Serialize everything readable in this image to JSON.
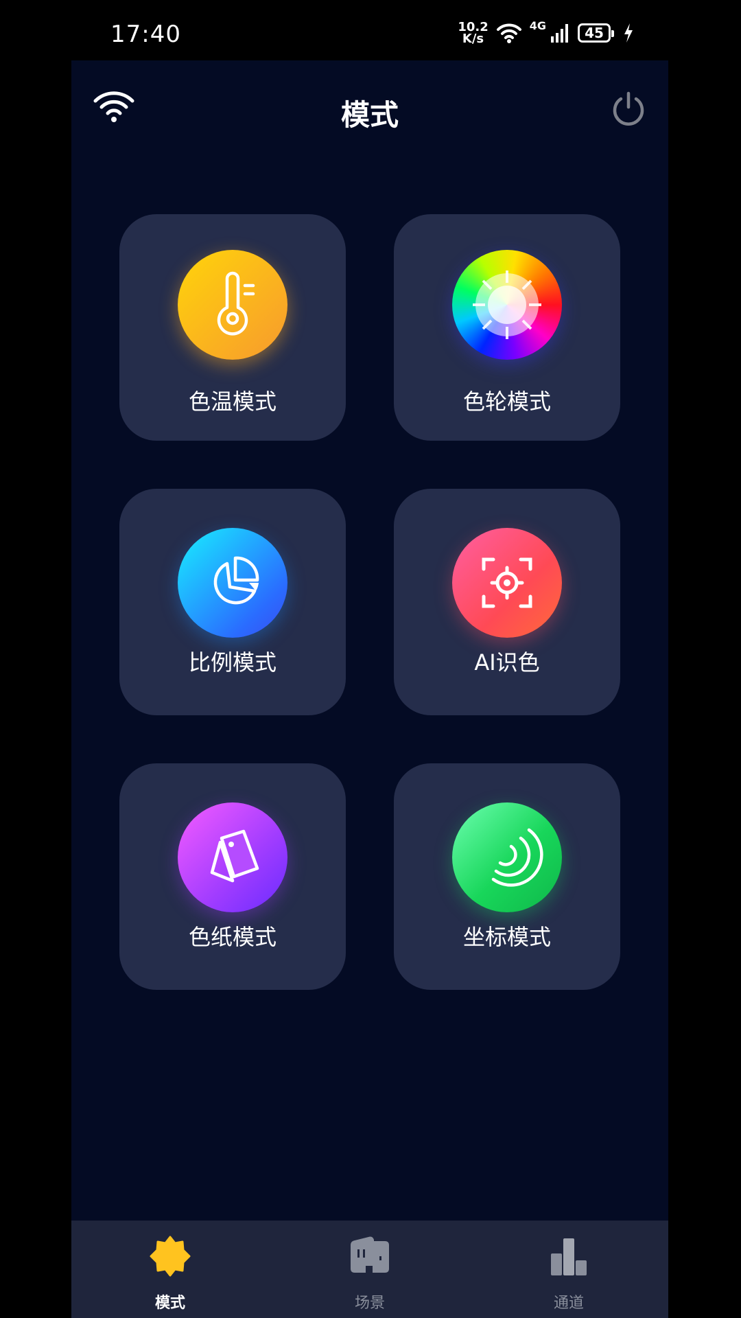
{
  "status_bar": {
    "time": "17:40",
    "net_speed_value": "10.2",
    "net_speed_unit": "K/s",
    "network_type": "4G",
    "battery": "45",
    "charging": true
  },
  "header": {
    "title": "模式"
  },
  "modes": [
    {
      "label": "色温模式",
      "icon": "thermometer-icon",
      "color": "#FFC107"
    },
    {
      "label": "色轮模式",
      "icon": "color-wheel-icon",
      "color": "rainbow"
    },
    {
      "label": "比例模式",
      "icon": "pie-chart-icon",
      "color": "#2A7BFF"
    },
    {
      "label": "AI识色",
      "icon": "scan-target-icon",
      "color": "#FF4F6A"
    },
    {
      "label": "色纸模式",
      "icon": "color-paper-icon",
      "color": "#B03CFF"
    },
    {
      "label": "坐标模式",
      "icon": "arc-icon",
      "color": "#1ED760"
    }
  ],
  "bottom_nav": {
    "items": [
      {
        "label": "模式",
        "icon": "mode-star-icon",
        "active": true
      },
      {
        "label": "场景",
        "icon": "scene-icon",
        "active": false
      },
      {
        "label": "通道",
        "icon": "channel-bars-icon",
        "active": false
      }
    ]
  },
  "colors": {
    "background": "#040B24",
    "card": "#252D4B",
    "nav_background": "#1F253C",
    "active_nav_icon": "#FFC31F",
    "inactive_nav": "#8A8F9C"
  }
}
